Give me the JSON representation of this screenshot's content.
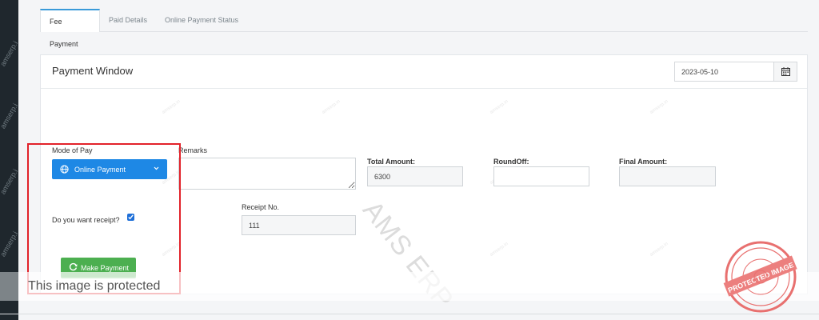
{
  "sidebar_watermark": "amserp.i",
  "tabs": [
    {
      "label": "Fee Payment",
      "active": true
    },
    {
      "label": "Paid Details",
      "active": false
    },
    {
      "label": "Online Payment Status",
      "active": false
    }
  ],
  "panel": {
    "title": "Payment Window",
    "date_value": "2023-05-10"
  },
  "form": {
    "mode_label": "Mode of Pay",
    "mode_value": "Online Payment",
    "remarks_label": "Remarks",
    "remarks_value": "",
    "total_amount_label": "Total Amount:",
    "total_amount_value": "6300",
    "roundoff_label": "RoundOff:",
    "roundoff_value": "",
    "final_amount_label": "Final Amount:",
    "final_amount_value": "",
    "receipt_question": "Do you want receipt?",
    "receipt_checked": true,
    "receipt_no_label": "Receipt No.",
    "receipt_no_value": "111",
    "make_payment_label": "Make Payment"
  },
  "watermark": "AMS ERP",
  "protected_notice": "This image is protected",
  "stamp_text": "PROTECTED IMAGE",
  "colors": {
    "accent": "#1e88e5",
    "success": "#4caf50",
    "highlight": "#e2222a",
    "sidebar": "#1f272d"
  }
}
